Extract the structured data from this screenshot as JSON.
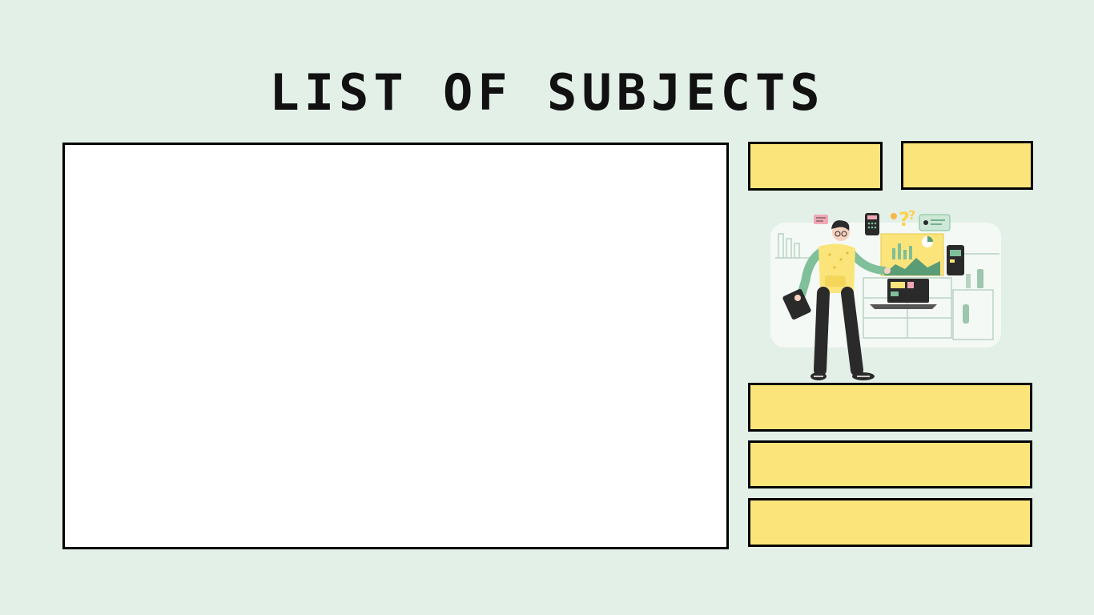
{
  "page": {
    "title": "LIST OF SUBJECTS",
    "background_color": "#e3f0e8",
    "accent_color": "#fbe57b"
  },
  "illustration": {
    "icon": "person-presenting-data-illustration"
  }
}
